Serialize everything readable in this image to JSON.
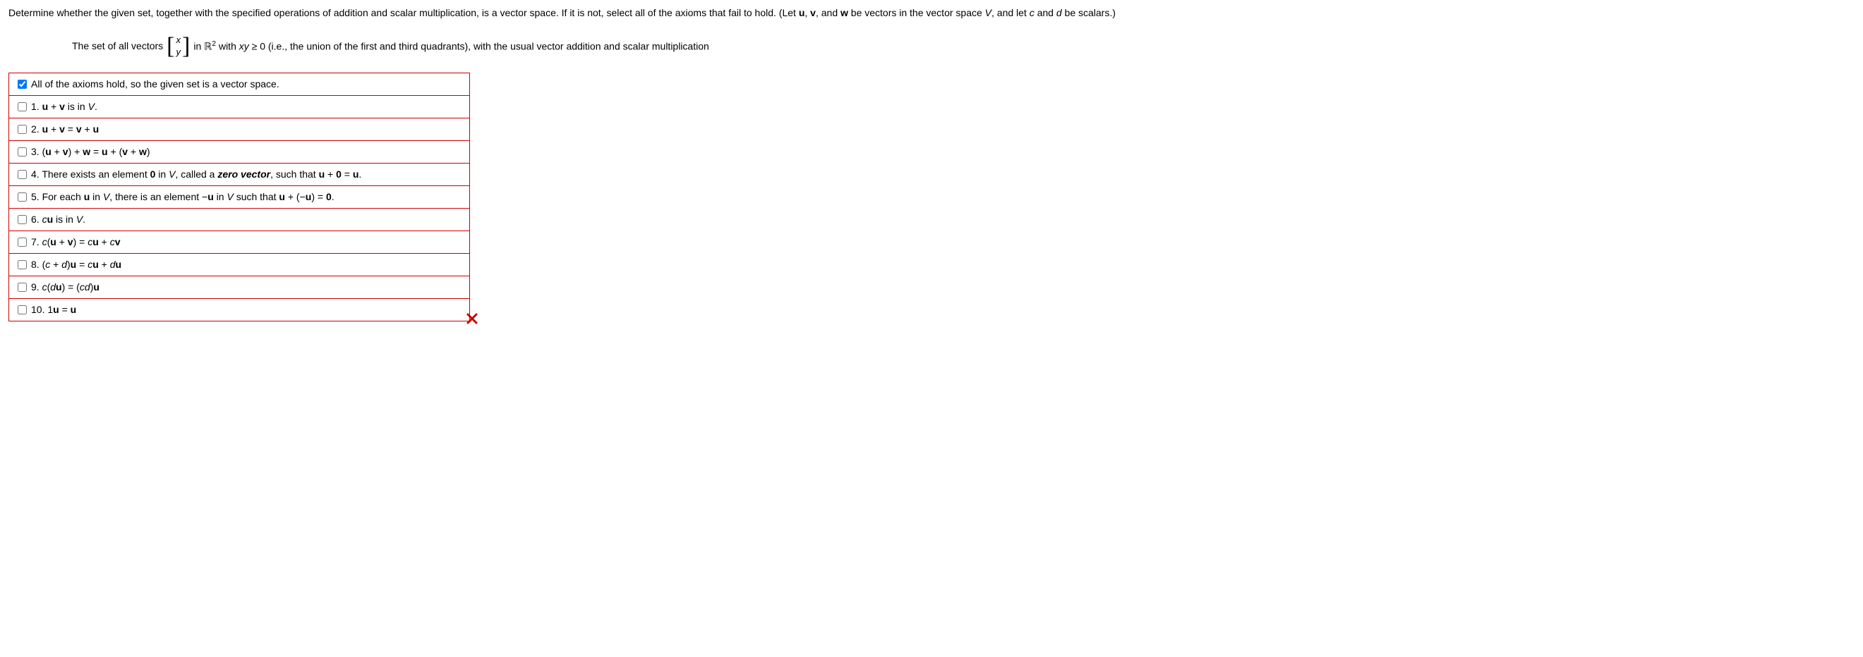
{
  "question": {
    "intro_part1": "Determine whether the given set, together with the specified operations of addition and scalar multiplication, is a vector space. If it is not, select all of the axioms that fail to hold. (Let ",
    "u": "u",
    "comma1": ", ",
    "v": "v",
    "comma2": ", and ",
    "w": "w",
    "intro_part2": " be vectors in the vector space ",
    "V": "V",
    "intro_part3": ", and let ",
    "c": "c",
    "and": " and ",
    "d": "d",
    "intro_part4": " be scalars.)"
  },
  "detail": {
    "part1": "The set of all vectors ",
    "matrix_top": "x",
    "matrix_bottom": "y",
    "part2": " in ",
    "R": "ℝ",
    "sup": "2",
    "part3": " with ",
    "xy": "xy",
    "part4": " ≥ 0 (i.e., the union of the first and third quadrants), with the usual vector addition and scalar multiplication"
  },
  "options": {
    "opt0": {
      "checked": true,
      "label": "All of the axioms hold, so the given set is a vector space."
    },
    "opt1": {
      "checked": false,
      "p1": "1. ",
      "b1": "u",
      "p2": " + ",
      "b2": "v",
      "p3": " is in ",
      "i1": "V",
      "p4": "."
    },
    "opt2": {
      "checked": false,
      "p1": "2. ",
      "b1": "u",
      "p2": " + ",
      "b2": "v",
      "p3": " = ",
      "b3": "v",
      "p4": " + ",
      "b4": "u"
    },
    "opt3": {
      "checked": false,
      "p1": "3. (",
      "b1": "u",
      "p2": " + ",
      "b2": "v",
      "p3": ") + ",
      "b3": "w",
      "p4": " = ",
      "b4": "u",
      "p5": " + (",
      "b5": "v",
      "p6": " + ",
      "b6": "w",
      "p7": ")"
    },
    "opt4": {
      "checked": false,
      "p1": "4. There exists an element ",
      "b1": "0",
      "p2": " in ",
      "i1": "V",
      "p3": ", called a ",
      "bi1": "zero vector",
      "p4": ", such that ",
      "b2": "u",
      "p5": " + ",
      "b3": "0",
      "p6": " = ",
      "b4": "u",
      "p7": "."
    },
    "opt5": {
      "checked": false,
      "p1": "5. For each ",
      "b1": "u",
      "p2": " in ",
      "i1": "V",
      "p3": ", there is an element −",
      "b2": "u",
      "p4": " in ",
      "i2": "V",
      "p5": " such that ",
      "b3": "u",
      "p6": " + (−",
      "b4": "u",
      "p7": ") = ",
      "b5": "0",
      "p8": "."
    },
    "opt6": {
      "checked": false,
      "p1": "6. ",
      "i1": "c",
      "b1": "u",
      "p2": " is in ",
      "i2": "V",
      "p3": "."
    },
    "opt7": {
      "checked": false,
      "p1": "7. ",
      "i1": "c",
      "p2": "(",
      "b1": "u",
      "p3": " + ",
      "b2": "v",
      "p4": ") = ",
      "i2": "c",
      "b3": "u",
      "p5": " + ",
      "i3": "c",
      "b4": "v"
    },
    "opt8": {
      "checked": false,
      "p1": "8. (",
      "i1": "c",
      "p2": " + ",
      "i2": "d",
      "p3": ")",
      "b1": "u",
      "p4": " = ",
      "i3": "c",
      "b2": "u",
      "p5": " + ",
      "i4": "d",
      "b3": "u"
    },
    "opt9": {
      "checked": false,
      "p1": "9. ",
      "i1": "c",
      "p2": "(",
      "i2": "d",
      "b1": "u",
      "p3": ") = (",
      "i3": "cd",
      "p4": ")",
      "b2": "u"
    },
    "opt10": {
      "checked": false,
      "p1": "10. 1",
      "b1": "u",
      "p2": " = ",
      "b2": "u"
    }
  }
}
